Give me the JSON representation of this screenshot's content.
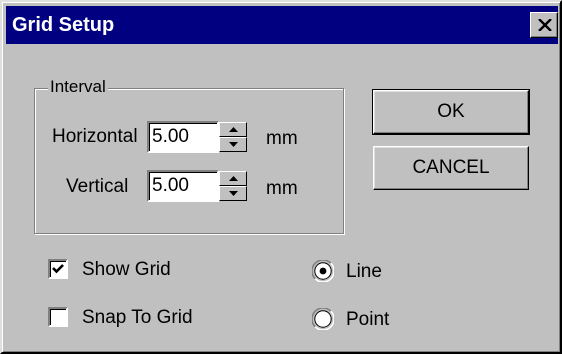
{
  "window": {
    "title": "Grid Setup"
  },
  "interval": {
    "group_label": "Interval",
    "horizontal": {
      "label": "Horizontal",
      "value": "5.00",
      "unit": "mm"
    },
    "vertical": {
      "label": "Vertical",
      "value": "5.00",
      "unit": "mm"
    }
  },
  "buttons": {
    "ok": "OK",
    "cancel": "CANCEL"
  },
  "options": {
    "show_grid": {
      "label": "Show Grid",
      "checked": true
    },
    "snap_to_grid": {
      "label": "Snap To Grid",
      "checked": false
    }
  },
  "grid_style": {
    "selected": "Line",
    "line": {
      "label": "Line",
      "selected": true
    },
    "point": {
      "label": "Point",
      "selected": false
    }
  },
  "icons": {
    "close": "close-icon",
    "spin_up": "spin-up-arrow-icon",
    "spin_down": "spin-down-arrow-icon",
    "check": "checkmark-icon"
  }
}
